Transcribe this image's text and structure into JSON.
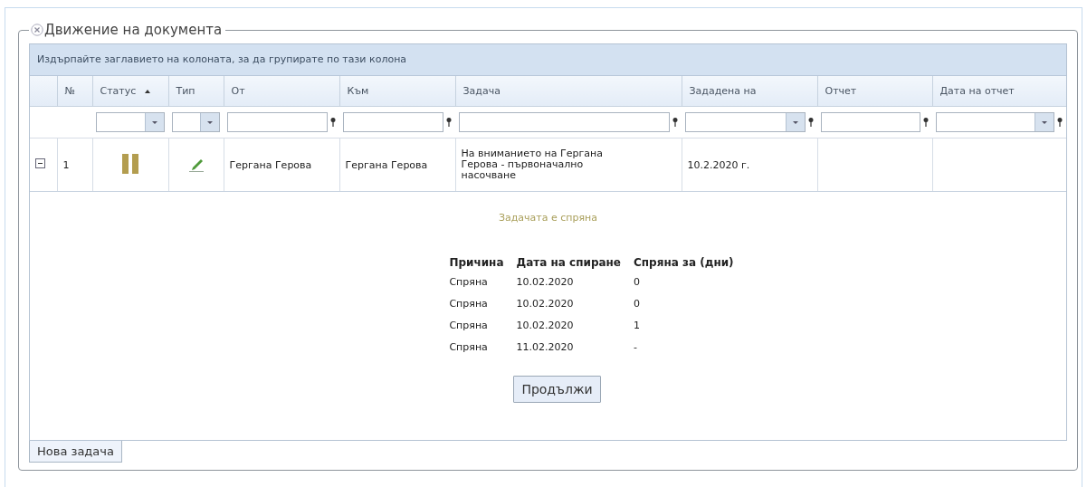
{
  "panel": {
    "title": "Движение на документа"
  },
  "grid": {
    "group_hint": "Издърпайте заглавието на колоната, за да групирате по тази колона",
    "columns": [
      {
        "label": "№"
      },
      {
        "label": "Статус",
        "sorted_ascending": true,
        "filter": {
          "kind": "combo"
        }
      },
      {
        "label": "Тип",
        "filter": {
          "kind": "combo"
        }
      },
      {
        "label": "От",
        "filter": {
          "kind": "text"
        }
      },
      {
        "label": "Към",
        "filter": {
          "kind": "text"
        }
      },
      {
        "label": "Задача",
        "filter": {
          "kind": "text"
        }
      },
      {
        "label": "Зададена на",
        "filter": {
          "kind": "combopin"
        }
      },
      {
        "label": "Отчет",
        "filter": {
          "kind": "text"
        }
      },
      {
        "label": "Дата на отчет",
        "filter": {
          "kind": "combopin"
        }
      }
    ],
    "rows": [
      {
        "expanded": true,
        "paused": true,
        "cells": [
          "1",
          null,
          null,
          "Гергана Герова",
          "Гергана Герова",
          "На вниманието на Гергана Герова - първоначално насочване",
          "10.2.2020 г.",
          null,
          null
        ],
        "detail": {
          "message": "Задачата е спряна",
          "columns": [
            "Причина",
            "Дата на спиране",
            "Спряна за (дни)"
          ],
          "rows": [
            [
              "Спряна",
              "10.02.2020",
              "0"
            ],
            [
              "Спряна",
              "10.02.2020",
              "0"
            ],
            [
              "Спряна",
              "10.02.2020",
              "1"
            ],
            [
              "Спряна",
              "11.02.2020",
              "-"
            ]
          ],
          "button": "Продължи"
        }
      }
    ]
  },
  "footer_button": "Нова задача"
}
